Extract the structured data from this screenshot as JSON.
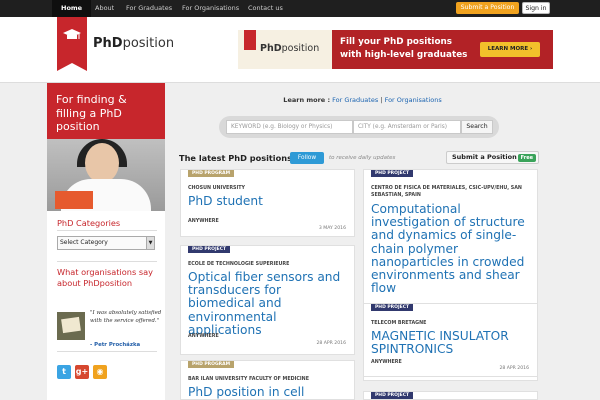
{
  "topnav": {
    "items": [
      "Home",
      "About",
      "For Graduates",
      "For Organisations",
      "Contact us"
    ],
    "submit_label": "Submit a Position",
    "signin_label": "Sign in"
  },
  "header": {
    "logo_bold": "PhD",
    "logo_rest": "position",
    "banner": {
      "logo_bold": "PhD",
      "logo_rest": "position",
      "headline": "Fill your PhD positions with high-level graduates",
      "button": "LEARN MORE ›"
    }
  },
  "sidebar": {
    "hero_text": "For finding & filling a PhD position",
    "categories_title": "PhD Categories",
    "category_select": "Select Category",
    "orgs_title": "What organisations say about PhDposition",
    "quote": "\"I was absolutely satisfied with the service offered.\"",
    "quote_author": "- Petr Procházka",
    "social": [
      "twitter-icon",
      "google-plus-icon",
      "rss-icon"
    ]
  },
  "main": {
    "learn_prefix": "Learn more :",
    "learn_graduates": "For Graduates",
    "learn_sep": "|",
    "learn_orgs": "For Organisations",
    "search": {
      "keyword_placeholder": "KEYWORD (e.g. Biology or Physics)",
      "city_placeholder": "CITY (e.g. Amsterdam or Paris)",
      "button": "Search"
    },
    "latest_title": "The latest PhD positions",
    "follow_label": "Follow",
    "follow_note": "to receive daily updates",
    "submit_label": "Submit a Position",
    "free_label": "Free",
    "cards": [
      {
        "tag": "PHD PROGRAM",
        "institution": "CHOSUN UNIVERSITY",
        "title": "PhD student",
        "location": "ANYWHERE",
        "date": "3 MAY 2016"
      },
      {
        "tag": "PHD PROJECT",
        "institution": "CENTRO DE FISICA DE MATERIALES, CSIC-UPV/EHU, SAN SEBASTIAN, SPAIN",
        "title": "Computational investigation of structure and dynamics of single-chain polymer nanoparticles in crowded environments and shear flow",
        "location": "ANYWHERE",
        "date": "2 MAY 2016"
      },
      {
        "tag": "PHD PROJECT",
        "institution": "ECOLE DE TECHNOLOGIE SUPERIEURE",
        "title": "Optical fiber sensors and transducers for biomedical and environmental applications",
        "location": "ANYWHERE",
        "date": "28 APR 2016"
      },
      {
        "tag": "PHD PROJECT",
        "institution": "TELECOM BRETAGNE",
        "title": "MAGNETIC INSULATOR SPINTRONICS",
        "location": "ANYWHERE",
        "date": "28 APR 2016"
      },
      {
        "tag": "PHD PROGRAM",
        "institution": "BAR ILAN UNIVERSITY FACULTY OF MEDICINE",
        "title": "PhD position in cell",
        "location": "",
        "date": ""
      },
      {
        "tag": "PHD PROJECT",
        "institution": "",
        "title": "",
        "location": "",
        "date": ""
      }
    ]
  }
}
